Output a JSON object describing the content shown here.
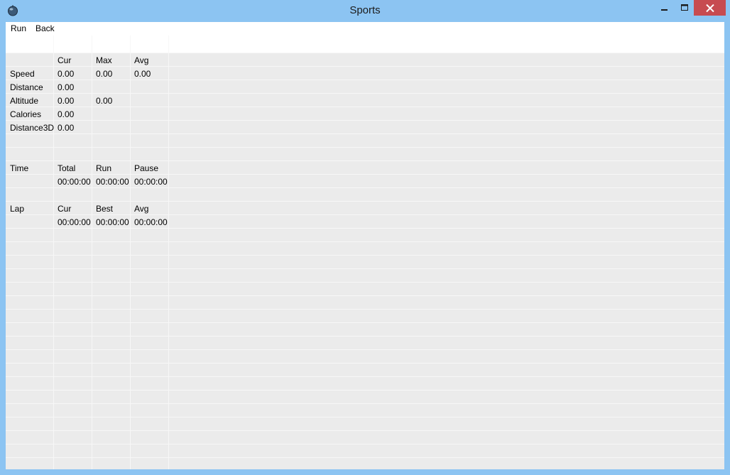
{
  "window": {
    "title": "Sports"
  },
  "menu": {
    "run": "Run",
    "back": "Back"
  },
  "grid": {
    "stats_header": {
      "cur": "Cur",
      "max": "Max",
      "avg": "Avg"
    },
    "speed": {
      "label": "Speed",
      "cur": "0.00",
      "max": "0.00",
      "avg": "0.00"
    },
    "distance": {
      "label": "Distance",
      "cur": "0.00"
    },
    "altitude": {
      "label": "Altitude",
      "cur": "0.00",
      "max": "0.00"
    },
    "calories": {
      "label": "Calories",
      "cur": "0.00"
    },
    "distance3d": {
      "label": "Distance3D",
      "cur": "0.00"
    },
    "time_header": {
      "label": "Time",
      "total": "Total",
      "run": "Run",
      "pause": "Pause"
    },
    "time_values": {
      "total": "00:00:00",
      "run": "00:00:00",
      "pause": "00:00:00"
    },
    "lap_header": {
      "label": "Lap",
      "cur": "Cur",
      "best": "Best",
      "avg": "Avg"
    },
    "lap_values": {
      "cur": "00:00:00",
      "best": "00:00:00",
      "avg": "00:00:00"
    }
  },
  "colors": {
    "title_bar": "#8cc4f2",
    "close_button": "#c74b50",
    "grid_background": "#ebebeb"
  }
}
